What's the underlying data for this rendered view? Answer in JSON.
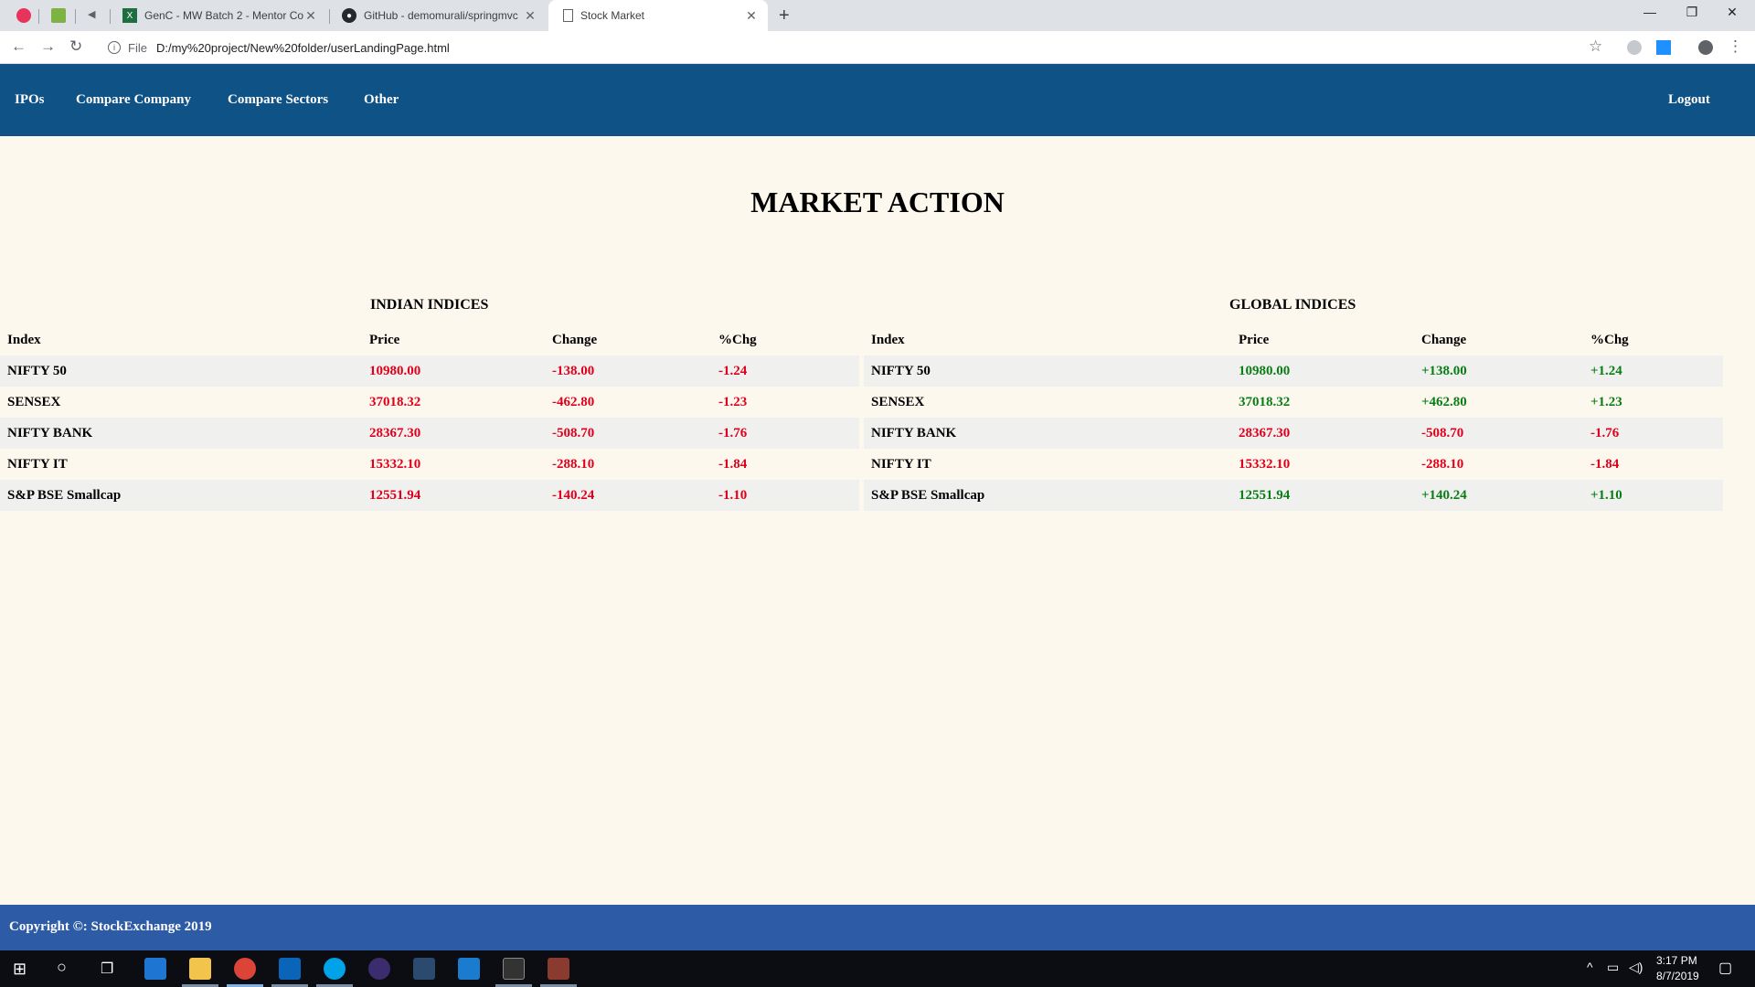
{
  "browser": {
    "tabs": [
      {
        "title": "GenC - MW Batch 2 - Mentor Co"
      },
      {
        "title": "GitHub - demomurali/springmvc"
      },
      {
        "title": "Stock Market"
      }
    ],
    "address_scheme": "File",
    "address_url": "D:/my%20project/New%20folder/userLandingPage.html"
  },
  "nav": {
    "ipos": "IPOs",
    "compare_company": "Compare Company",
    "compare_sectors": "Compare Sectors",
    "other": "Other",
    "logout": "Logout"
  },
  "page_title": "MARKET ACTION",
  "indian": {
    "heading": "INDIAN INDICES",
    "columns": [
      "Index",
      "Price",
      "Change",
      "%Chg"
    ],
    "rows": [
      {
        "name": "NIFTY 50",
        "price": "10980.00",
        "change": "-138.00",
        "pct": "-1.24"
      },
      {
        "name": "SENSEX",
        "price": "37018.32",
        "change": "-462.80",
        "pct": "-1.23"
      },
      {
        "name": "NIFTY BANK",
        "price": "28367.30",
        "change": "-508.70",
        "pct": "-1.76"
      },
      {
        "name": "NIFTY IT",
        "price": "15332.10",
        "change": "-288.10",
        "pct": "-1.84"
      },
      {
        "name": "S&P BSE Smallcap",
        "price": "12551.94",
        "change": "-140.24",
        "pct": "-1.10"
      }
    ]
  },
  "global": {
    "heading": "GLOBAL INDICES",
    "columns": [
      "Index",
      "Price",
      "Change",
      "%Chg"
    ],
    "rows": [
      {
        "name": "NIFTY 50",
        "price": "10980.00",
        "change": "+138.00",
        "pct": "+1.24"
      },
      {
        "name": "SENSEX",
        "price": "37018.32",
        "change": "+462.80",
        "pct": "+1.23"
      },
      {
        "name": "NIFTY BANK",
        "price": "28367.30",
        "change": "-508.70",
        "pct": "-1.76"
      },
      {
        "name": "NIFTY IT",
        "price": "15332.10",
        "change": "-288.10",
        "pct": "-1.84"
      },
      {
        "name": "S&P BSE Smallcap",
        "price": "12551.94",
        "change": "+140.24",
        "pct": "+1.10"
      }
    ]
  },
  "footer": "Copyright ©: StockExchange 2019",
  "taskbar": {
    "time": "3:17 PM",
    "date": "8/7/2019"
  },
  "colors": {
    "navbar": "#0f5285",
    "footer": "#2e5ba6",
    "negative": "#e0001b",
    "positive": "#0a7d16",
    "page_bg": "#fdf8ee"
  }
}
